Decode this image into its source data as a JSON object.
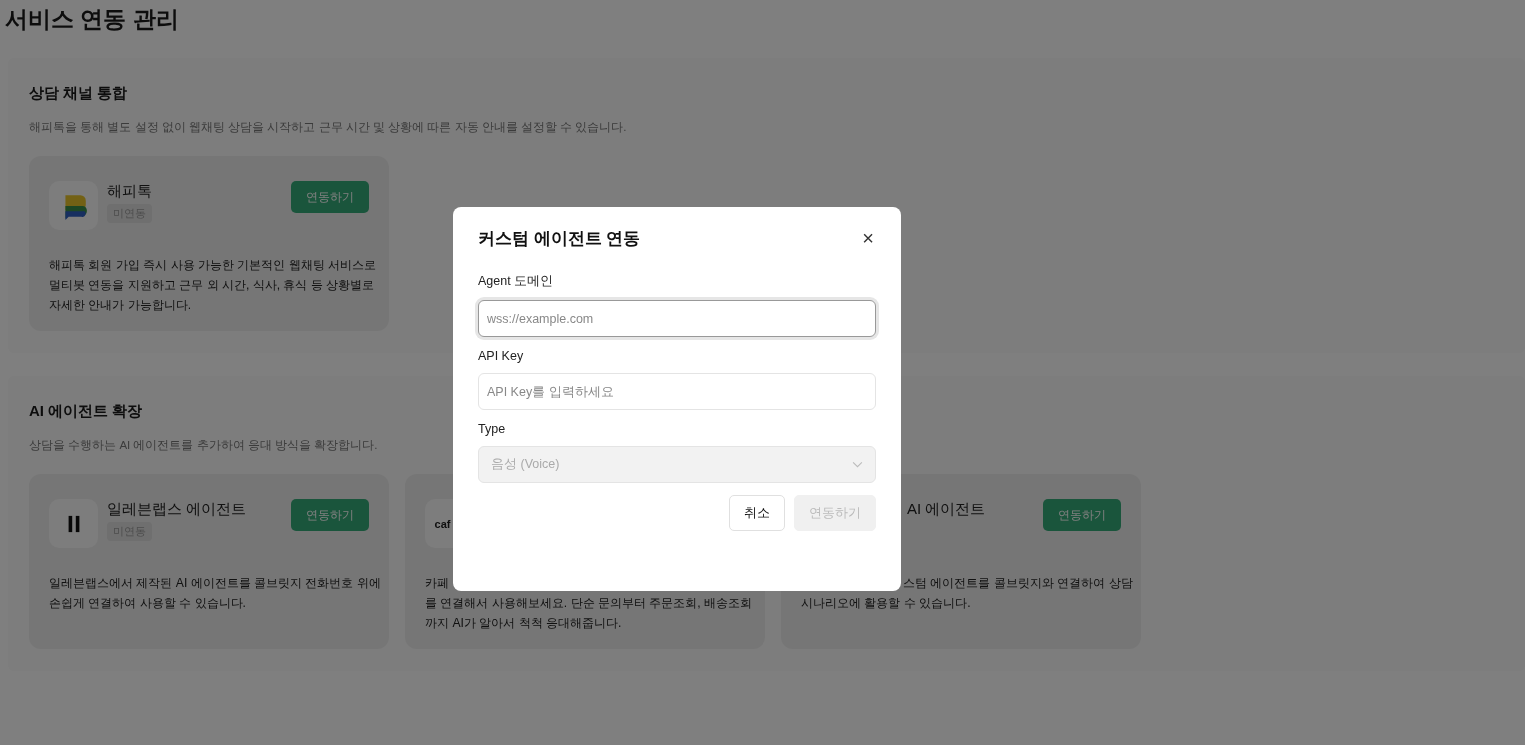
{
  "page_title": "서비스 연동 관리",
  "sections": [
    {
      "title": "상담 채널 통합",
      "description": "해피톡을 통해 별도 설정 없이 웹채팅 상담을 시작하고 근무 시간 및 상황에 따른 자동 안내를 설정할 수 있습니다.",
      "cards": [
        {
          "logo": {
            "kind": "bubble"
          },
          "name": "해피톡",
          "badge": "미연동",
          "button": "연동하기",
          "description_lines": [
            "해피톡 회원 가입 즉시 사용 가능한 기본적인 웹채팅 서비스로",
            "멀티봇 연동을 지원하고 근무 외 시간, 식사, 휴식 등 상황별로",
            "자세한 안내가 가능합니다."
          ]
        }
      ]
    },
    {
      "title": "AI 에이전트 확장",
      "description": "상담을 수행하는 AI 에이전트를 추가하여 응대 방식을 확장합니다.",
      "cards": [
        {
          "logo": {
            "kind": "bars"
          },
          "name": "일레븐랩스 에이전트",
          "badge": "미연동",
          "button": "연동하기",
          "description_lines": [
            "일레븐랩스에서 제작된 AI 에이전트를 콜브릿지 전화번호 위에",
            "손쉽게 연결하여 사용할 수 있습니다."
          ]
        },
        {
          "logo": {
            "kind": "text",
            "text": "caf"
          },
          "description_lines": [
            "카페",
            "를 연결해서 사용해보세요. 단순 문의부터 주문조회, 배송조회",
            "까지 AI가 알아서 척척 응대해줍니다."
          ]
        },
        {
          "partly_covered": true,
          "name": "AI 에이전트",
          "button": "연동하기",
          "description_lines": [
            "스텀 에이전트를 콜브릿지와 연결하여 상담",
            "시나리오에 활용할 수 있습니다."
          ]
        }
      ]
    }
  ],
  "modal": {
    "title": "커스텀 에이전트 연동",
    "close": "×",
    "fields": [
      {
        "kind": "input",
        "label": "Agent 도메인",
        "placeholder": "wss://example.com",
        "focused": true
      },
      {
        "kind": "input",
        "label": "API Key",
        "placeholder": "API Key를 입력하세요",
        "focused": false
      },
      {
        "kind": "select",
        "label": "Type",
        "value": "음성 (Voice)",
        "disabled": true
      }
    ],
    "buttons": [
      {
        "label": "취소",
        "disabled": false
      },
      {
        "label": "연동하기",
        "disabled": true
      }
    ]
  }
}
